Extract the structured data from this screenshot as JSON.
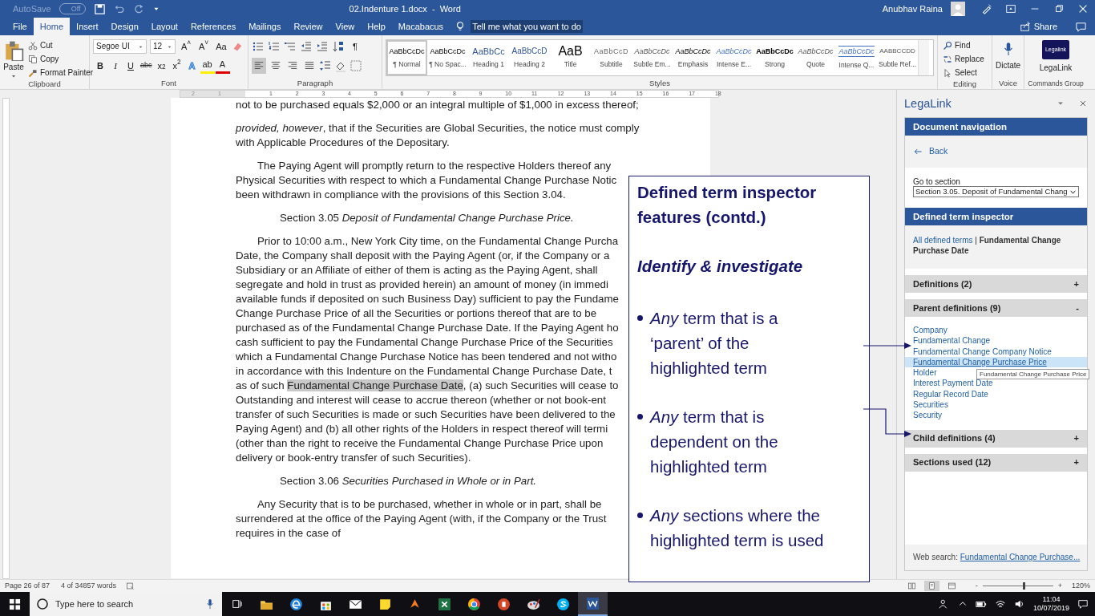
{
  "title_bar": {
    "autosave": {
      "label": "AutoSave",
      "on": false,
      "state": "Off"
    },
    "title": "02.Indenture 1.docx  -  Word",
    "user": "Anubhav Raina"
  },
  "ribbon_tabs": [
    {
      "label": "File",
      "selected": false
    },
    {
      "label": "Home",
      "selected": true
    },
    {
      "label": "Insert",
      "selected": false
    },
    {
      "label": "Design",
      "selected": false
    },
    {
      "label": "Layout",
      "selected": false
    },
    {
      "label": "References",
      "selected": false
    },
    {
      "label": "Mailings",
      "selected": false
    },
    {
      "label": "Review",
      "selected": false
    },
    {
      "label": "View",
      "selected": false
    },
    {
      "label": "Help",
      "selected": false
    },
    {
      "label": "Macabacus",
      "selected": false
    }
  ],
  "tell_me": "Tell me what you want to do",
  "share": "Share",
  "clipboard": {
    "paste": "Paste",
    "items": [
      {
        "kind": "cut",
        "label": "Cut"
      },
      {
        "kind": "copy",
        "label": "Copy"
      },
      {
        "kind": "brush",
        "label": "Format Painter"
      }
    ],
    "label": "Clipboard"
  },
  "font": {
    "name": "Segoe UI",
    "size": "12",
    "row1": [
      {
        "kind": "plain",
        "label": "A$^{˄}$"
      },
      {
        "kind": "plain",
        "label": "A$^{˅}$"
      },
      {
        "kind": "plain",
        "label": "Aa"
      }
    ],
    "row2": [
      {
        "kind": "bold",
        "label": "B"
      },
      {
        "kind": "italic",
        "label": "I"
      },
      {
        "kind": "underline",
        "label": "U"
      },
      {
        "kind": "strike",
        "label": "abc"
      },
      {
        "kind": "plain",
        "label": "x$_{2}$"
      },
      {
        "kind": "plain",
        "label": "x$^{2}$"
      },
      {
        "kind": "effects",
        "label": "A"
      },
      {
        "kind": "highlight",
        "label": "ab"
      },
      {
        "kind": "color",
        "label": "A"
      }
    ],
    "label": "Font"
  },
  "paragraph": {
    "pilcrow": "¶",
    "alignment": [
      {
        "kind": "left",
        "selected": true
      },
      {
        "kind": "center",
        "selected": false
      },
      {
        "kind": "right",
        "selected": false
      },
      {
        "kind": "justify",
        "selected": false
      }
    ],
    "label": "Paragraph"
  },
  "styles": {
    "label": "Styles",
    "items": [
      {
        "kind": "normal",
        "preview": "AaBbCcDc",
        "name": "¶ Normal",
        "selected": true
      },
      {
        "kind": "normal",
        "preview": "AaBbCcDc",
        "name": "¶ No Spac...",
        "selected": false
      },
      {
        "kind": "heading1",
        "preview": "AaBbCc",
        "name": "Heading 1",
        "selected": false
      },
      {
        "kind": "heading2",
        "preview": "AaBbCcD",
        "name": "Heading 2",
        "selected": false
      },
      {
        "kind": "title",
        "preview": "AaB",
        "name": "Title",
        "selected": false
      },
      {
        "kind": "subtitle",
        "preview": "AaBbCcD",
        "name": "Subtitle",
        "selected": false
      },
      {
        "kind": "subtle",
        "preview": "AaBbCcDc",
        "name": "Subtle Em...",
        "selected": false
      },
      {
        "kind": "emphasis",
        "preview": "AaBbCcDc",
        "name": "Emphasis",
        "selected": false
      },
      {
        "kind": "intense",
        "preview": "AaBbCcDc",
        "name": "Intense E...",
        "selected": false
      },
      {
        "kind": "strong",
        "preview": "AaBbCcDc",
        "name": "Strong",
        "selected": false
      },
      {
        "kind": "subtle",
        "preview": "AaBbCcDc",
        "name": "Quote",
        "selected": false
      },
      {
        "kind": "intenseq",
        "preview": "AaBbCcDc",
        "name": "Intense Q...",
        "selected": false
      },
      {
        "kind": "ref",
        "preview": "AABBCCDD",
        "name": "Subtle Ref...",
        "selected": false
      }
    ]
  },
  "editing": {
    "label": "Editing",
    "items": [
      {
        "kind": "find",
        "label": "Find"
      },
      {
        "kind": "replace",
        "label": "Replace"
      },
      {
        "kind": "select",
        "label": "Select"
      }
    ]
  },
  "voice": {
    "label": "Voice",
    "button": "Dictate"
  },
  "commands": {
    "label": "Commands Group",
    "button": "LegaLink",
    "logo": "Legalink"
  },
  "ruler": {
    "labels": [
      "2",
      "1",
      "1",
      "2",
      "3",
      "4",
      "5",
      "6",
      "7",
      "8",
      "9",
      "10",
      "11",
      "12",
      "13",
      "14",
      "15",
      "16",
      "17",
      "18"
    ]
  },
  "document": {
    "paragraphs": [
      {
        "kind": "plain",
        "lines": [
          {
            "text": "not to be purchased equals $2,000 or an integral multiple of $1,000 in excess thereof;"
          }
        ]
      },
      {
        "kind": "plain",
        "lines": [
          {
            "text": "*provided, however*, that if the Securities are Global Securities, the notice must comply"
          },
          {
            "text": "with Applicable Procedures of the Depositary."
          }
        ]
      },
      {
        "kind": "body",
        "lines": [
          {
            "text": "The Paying Agent will promptly return to the respective Holders thereof any"
          },
          {
            "text": "Physical Securities with respect to which a Fundamental Change Purchase Notic"
          },
          {
            "text": "been withdrawn in compliance with the provisions of this Section 3.04."
          }
        ]
      },
      {
        "kind": "heading",
        "lines": [
          {
            "text": "Section 3.05 *Deposit of Fundamental Change Purchase Price.*"
          }
        ]
      },
      {
        "kind": "body",
        "lines": [
          {
            "text": "Prior to 10:00 a.m., New York City time, on the Fundamental Change Purcha"
          },
          {
            "text": "Date, the Company shall deposit with the Paying Agent (or, if the Company or a"
          },
          {
            "text": "Subsidiary or an Affiliate of either of them is acting as the Paying Agent, shall"
          },
          {
            "text": "segregate and hold in trust as provided herein) an amount of money (in immedi"
          },
          {
            "text": "available funds if deposited on such Business Day) sufficient to pay the Fundame"
          },
          {
            "text": "Change Purchase Price of all the Securities or portions thereof that are to be"
          },
          {
            "text": "purchased as of the Fundamental Change Purchase Date. If the Paying Agent ho"
          },
          {
            "text": "cash sufficient to pay the Fundamental Change Purchase Price of the Securities"
          },
          {
            "text": "which a Fundamental Change Purchase Notice has been tendered and not witho"
          },
          {
            "text": "in accordance with this Indenture on the Fundamental Change Purchase Date, t"
          },
          {
            "parts": [
              {
                "text": "as of such ",
                "highlighted": false
              },
              {
                "text": "Fundamental Change Purchase Date",
                "highlighted": true
              },
              {
                "text": ", (a) such Securities will cease to",
                "highlighted": false
              }
            ]
          },
          {
            "text": "Outstanding and interest will cease to accrue thereon (whether or not book-ent"
          },
          {
            "text": "transfer of such Securities is made or such Securities have been delivered to the"
          },
          {
            "text": "Paying Agent) and (b) all other rights of the Holders in respect thereof will termi"
          },
          {
            "text": "(other than the right to receive the Fundamental Change Purchase Price upon"
          },
          {
            "text": "delivery or book-entry transfer of such Securities)."
          }
        ]
      },
      {
        "kind": "heading",
        "lines": [
          {
            "text": "Section 3.06 *Securities Purchased in Whole or in Part.*"
          }
        ]
      },
      {
        "kind": "body",
        "lines": [
          {
            "text": "Any Security that is to be purchased, whether in whole or in part, shall be"
          },
          {
            "text": "surrendered at the office of the Paying Agent (with, if the Company or the Trust"
          },
          {
            "text": "requires in the case of"
          }
        ]
      }
    ]
  },
  "callout": {
    "title": "Defined term inspector features (contd.)",
    "subtitle": "Identify & investigate",
    "bullets": [
      "*Any* term that is a ‘parent’ of the highlighted term",
      "*Any* term that is dependent on the highlighted term",
      "*Any* sections where the highlighted term is used"
    ]
  },
  "pane": {
    "title": "LegaLink",
    "nav_header": "Document navigation",
    "back": "Back",
    "goto_label": "Go to section",
    "goto_value": "Section 3.05. Deposit of Fundamental Chang",
    "inspector_header": "Defined term inspector",
    "all_terms": "All defined terms",
    "separator": "|",
    "current_term": "Fundamental Change Purchase Date",
    "sections": [
      {
        "label": "Definitions (2)",
        "sign": "+"
      },
      {
        "label": "Parent definitions (9)",
        "sign": "-",
        "items": [
          {
            "label": "Company",
            "hovered": false
          },
          {
            "label": "Fundamental Change",
            "hovered": false
          },
          {
            "label": "Fundamental Change Company Notice",
            "hovered": false
          },
          {
            "label": "Fundamental Change Purchase Price",
            "hovered": true,
            "tooltip": "Fundamental Change Purchase Price"
          },
          {
            "label": "Holder",
            "hovered": false
          },
          {
            "label": "Interest Payment Date",
            "hovered": false
          },
          {
            "label": "Regular Record Date",
            "hovered": false
          },
          {
            "label": "Securities",
            "hovered": false
          },
          {
            "label": "Security",
            "hovered": false
          }
        ]
      },
      {
        "label": "Child definitions (4)",
        "sign": "+"
      },
      {
        "label": "Sections used (12)",
        "sign": "+"
      }
    ],
    "web_search_label": "Web search:",
    "web_search_link": "Fundamental Change Purchase..."
  },
  "status_bar": {
    "page": "Page 26 of 87",
    "words": "4 of 34857 words",
    "views": [
      {
        "kind": "read",
        "selected": false
      },
      {
        "kind": "print",
        "selected": true
      },
      {
        "kind": "web",
        "selected": false
      }
    ],
    "zoom": {
      "minus": "-",
      "plus": "+",
      "level": 0.6,
      "reading": "120%"
    }
  },
  "taskbar": {
    "search": "Type here to search",
    "apps": [
      {
        "kind": "folder",
        "active": false
      },
      {
        "kind": "edge",
        "active": false
      },
      {
        "kind": "store",
        "active": false
      },
      {
        "kind": "mail",
        "active": false
      },
      {
        "kind": "note",
        "active": false
      },
      {
        "kind": "shield",
        "active": false
      },
      {
        "kind": "sheet",
        "active": false
      },
      {
        "kind": "chrome",
        "active": false
      },
      {
        "kind": "slides",
        "active": false
      },
      {
        "kind": "paint",
        "active": false
      },
      {
        "kind": "chat",
        "active": false
      },
      {
        "kind": "doc",
        "active": true
      }
    ],
    "time": "11:04",
    "date": "10/07/2019"
  }
}
